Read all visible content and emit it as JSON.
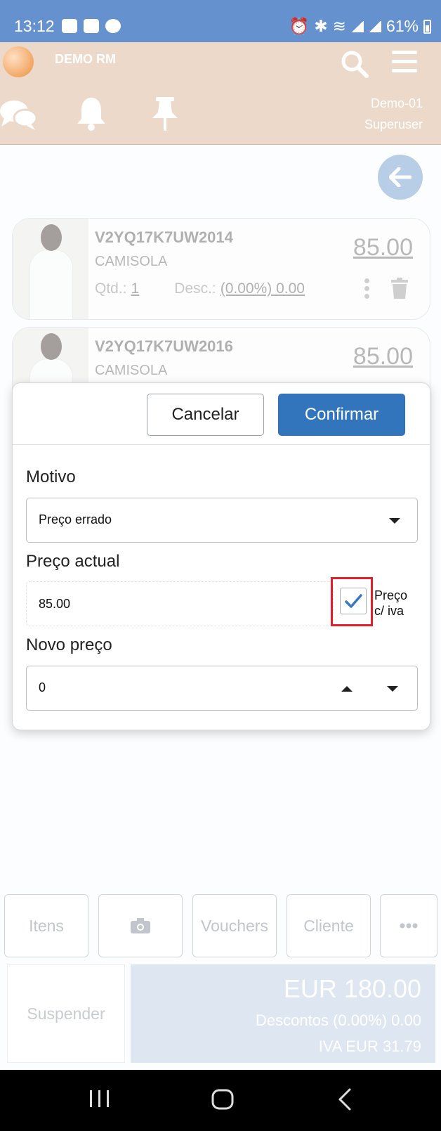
{
  "status_bar": {
    "time": "13:12",
    "battery": "61%"
  },
  "header": {
    "app_name": "DEMO RM",
    "user_line1": "Demo-01",
    "user_line2": "Superuser"
  },
  "products": [
    {
      "sku": "V2YQ17K7UW2014",
      "desc": "CAMISOLA",
      "price": "85.00",
      "qty_label": "Qtd.:",
      "qty": "1",
      "disc_label": "Desc.:",
      "disc": "(0.00%) 0.00"
    },
    {
      "sku": "V2YQ17K7UW2016",
      "desc": "CAMISOLA",
      "price": "85.00"
    }
  ],
  "dialog": {
    "cancel": "Cancelar",
    "confirm": "Confirmar",
    "motivo_label": "Motivo",
    "motivo_value": "Preço errado",
    "current_price_label": "Preço actual",
    "current_price": "85.00",
    "vat_checkbox_label_1": "Preço",
    "vat_checkbox_label_2": "c/ iva",
    "vat_checked": true,
    "new_price_label": "Novo preço",
    "new_price": "0"
  },
  "bottom": {
    "items": "Itens",
    "vouchers": "Vouchers",
    "client": "Cliente",
    "suspend": "Suspender",
    "total": "EUR 180.00",
    "discounts": "Descontos  (0.00%) 0.00",
    "vat": "IVA  EUR 31.79"
  },
  "colors": {
    "status_bar": "#6592cf",
    "app_bar": "#edd9c9",
    "primary": "#3275bd",
    "highlight": "#e0202a"
  }
}
